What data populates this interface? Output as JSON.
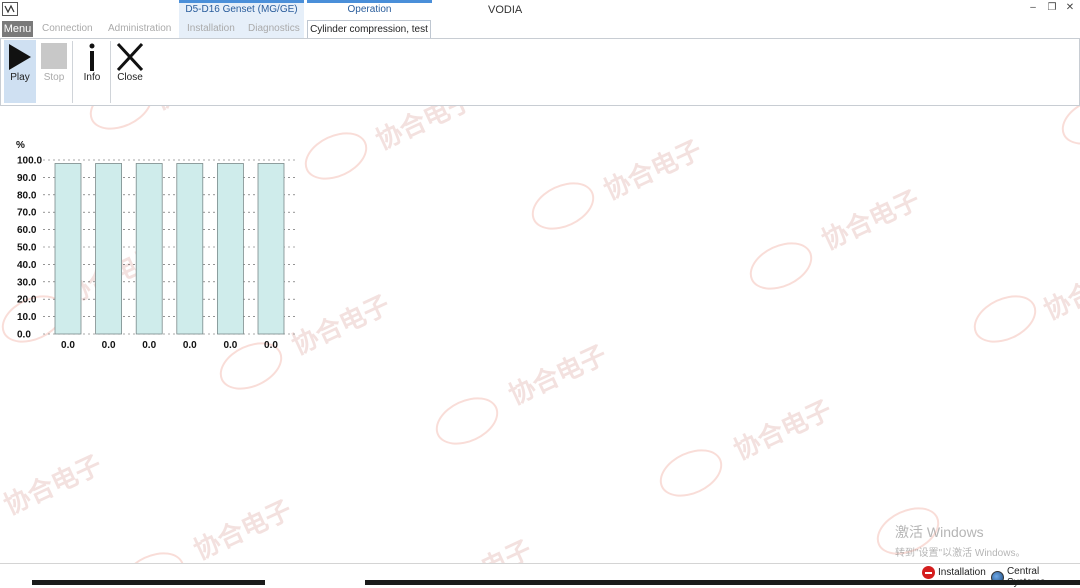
{
  "app": {
    "title": "VODIA"
  },
  "nav": {
    "menu": "Menu",
    "tabs": [
      "Connection",
      "Administration",
      "Installation",
      "Diagnostics"
    ],
    "group_product": "D5-D16 Genset (MG/GE)",
    "group_operation": "Operation",
    "active_tab": "Cylinder compression, test"
  },
  "window_controls": {
    "minimize": "–",
    "restore": "❐",
    "close": "✕"
  },
  "ribbon": {
    "play": "Play",
    "stop": "Stop",
    "info": "Info",
    "close": "Close"
  },
  "chart_data": {
    "type": "bar",
    "ylabel": "%",
    "yticks": [
      "100.0",
      "90.0",
      "80.0",
      "70.0",
      "60.0",
      "50.0",
      "40.0",
      "30.0",
      "20.0",
      "10.0",
      "0.0"
    ],
    "ylim": [
      0,
      100
    ],
    "bar_heights": [
      98,
      98,
      98,
      98,
      98,
      98
    ],
    "value_labels": [
      "0.0",
      "0.0",
      "0.0",
      "0.0",
      "0.0",
      "0.0"
    ],
    "grid": true
  },
  "status": {
    "installation": "Installation",
    "central_systems": "Central Systems"
  },
  "watermark": {
    "text": "协合电子",
    "activate_line1": "激活 Windows",
    "activate_line2": "转到\"设置\"以激活 Windows。"
  },
  "colors": {
    "bar_fill": "#cfeceb",
    "bar_stroke": "#7a8a8a",
    "accent": "#4a8fd9",
    "ribbon_active": "#cfe0f2"
  }
}
